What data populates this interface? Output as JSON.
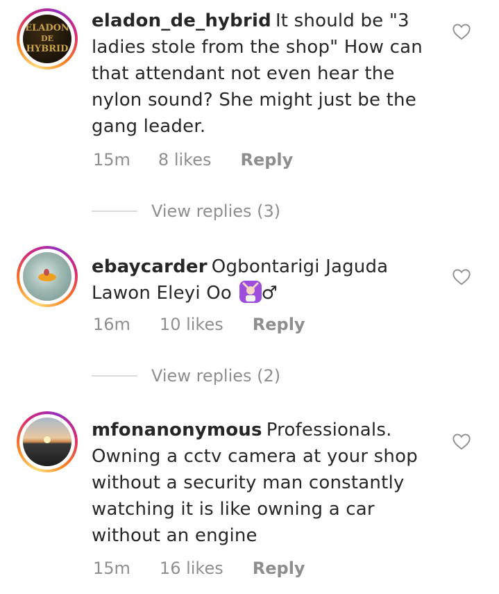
{
  "comments": [
    {
      "username": "eladon_de_hybrid",
      "text": "It should be \"3 ladies stole from the shop\" How can that attendant not even hear the nylon sound? She might just be the gang leader.",
      "time": "15m",
      "likes": "8 likes",
      "reply": "Reply",
      "view_replies": "View replies (3)",
      "avatar_text": [
        "ELADON",
        "DE",
        "HYBRID"
      ]
    },
    {
      "username": "ebaycarder",
      "text": "Ogbontarigi Jaguda Lawon Eleyi Oo",
      "emoji_suffix": "♂",
      "time": "16m",
      "likes": "10 likes",
      "reply": "Reply",
      "view_replies": "View replies (2)"
    },
    {
      "username": "mfonanonymous",
      "text": "Professionals. Owning a cctv camera at your shop without a security man constantly watching it is like owning a car without an engine",
      "time": "15m",
      "likes": "16 likes",
      "reply": "Reply"
    }
  ],
  "colors": {
    "text": "#262626",
    "meta": "#8e8e8e",
    "divider": "#dbdbdb"
  },
  "icons": {
    "like": "heart-outline-icon",
    "emoji": "person-gesturing-no-emoji"
  }
}
